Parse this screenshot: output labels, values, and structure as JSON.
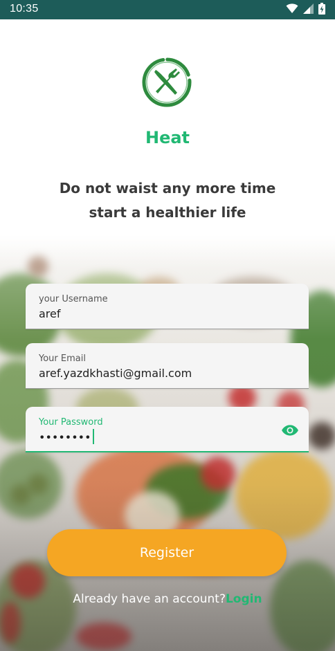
{
  "status_bar": {
    "time": "10:35",
    "icons": [
      "wifi-icon",
      "cellular-signal-icon",
      "battery-icon"
    ]
  },
  "app": {
    "name": "Heat",
    "logo": "fork-knife-icon",
    "tagline_line1": "Do not waist any more time",
    "tagline_line2": "start a healthier life"
  },
  "form": {
    "username": {
      "label": "your Username",
      "value": "aref"
    },
    "email": {
      "label": "Your Email",
      "value": "aref.yazdkhasti@gmail.com"
    },
    "password": {
      "label": "Your Password",
      "value": "••••••••",
      "toggle_icon": "eye-icon",
      "focused": true
    }
  },
  "actions": {
    "register_label": "Register",
    "login_prompt": "Already have an account?",
    "login_label": "Login"
  },
  "colors": {
    "status_bar": "#1d5c59",
    "brand_green": "#21b873",
    "button_orange": "#f5a623",
    "tagline_text": "#3a3a3a"
  }
}
